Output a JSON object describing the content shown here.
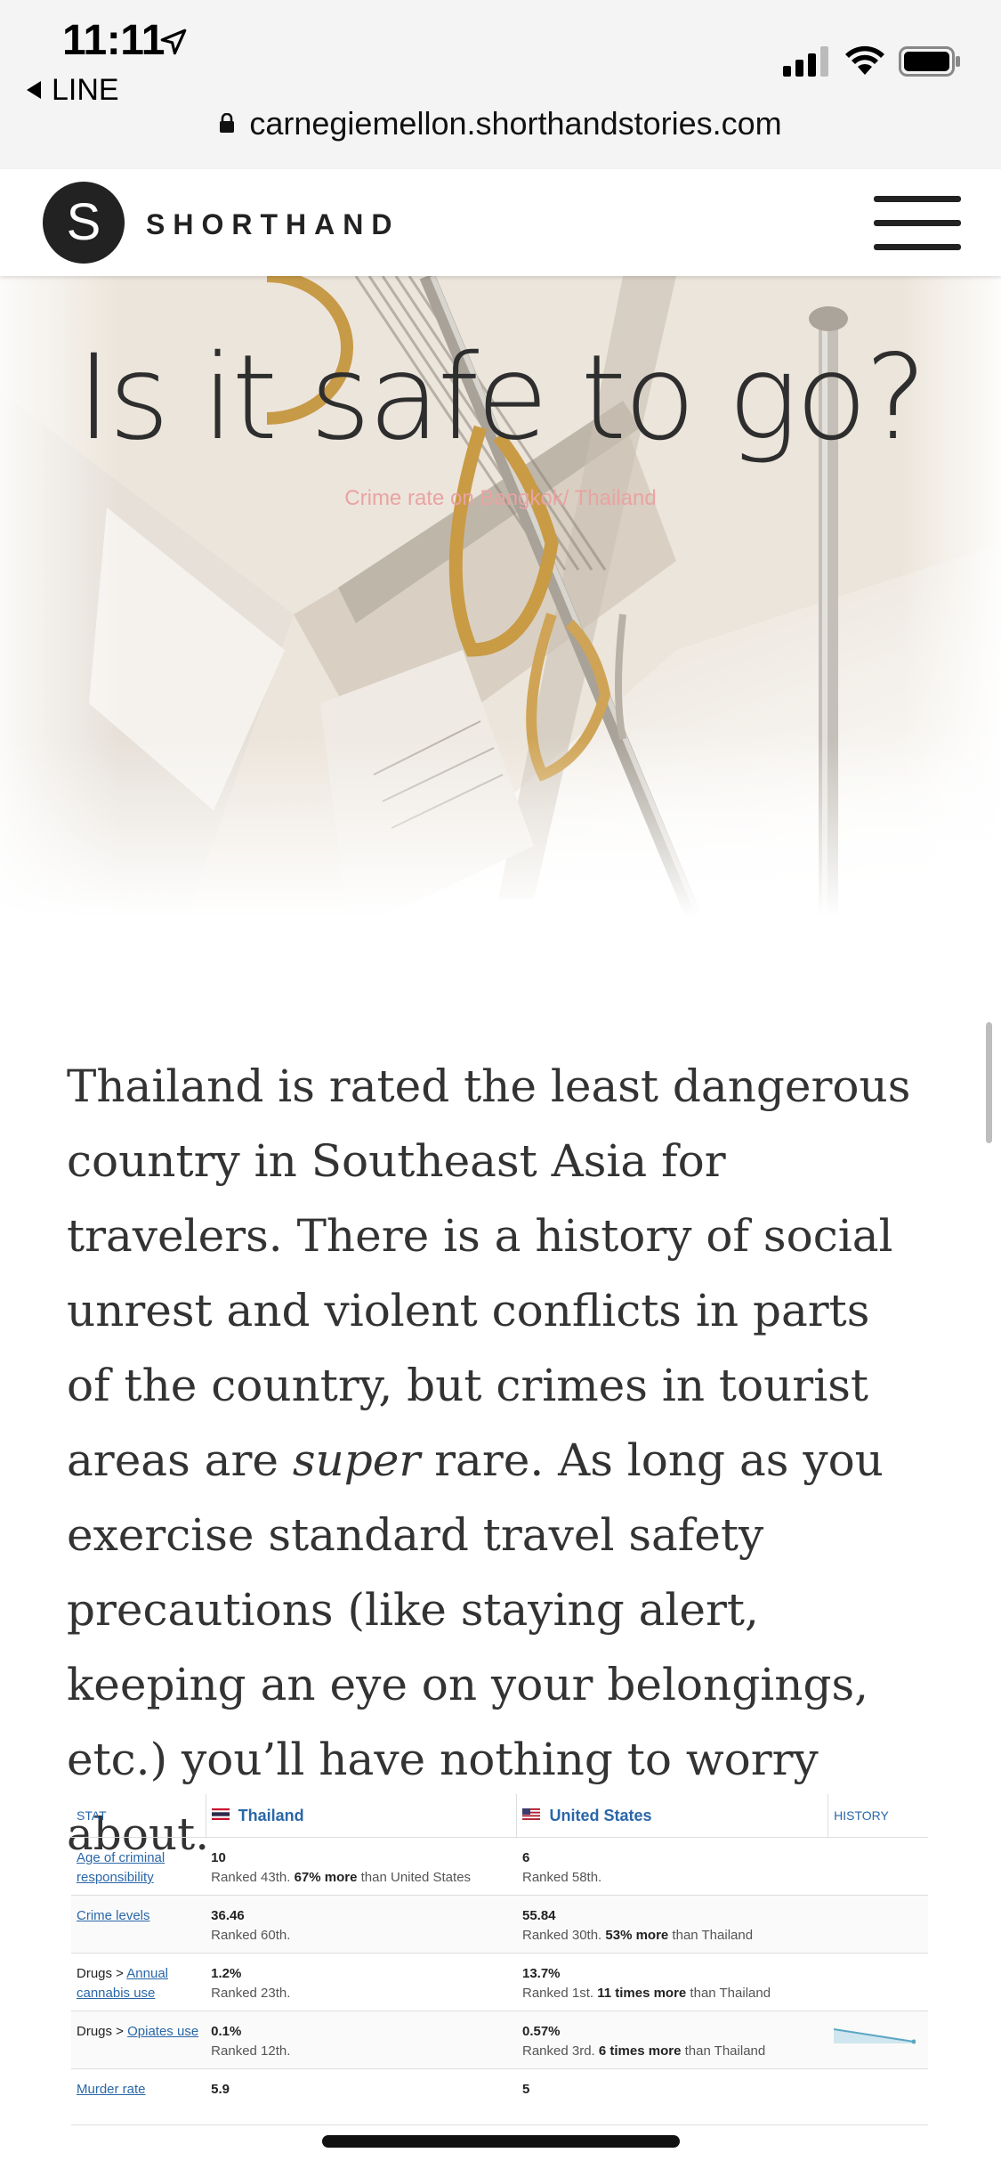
{
  "status_bar": {
    "time": "11:11",
    "back_app": "LINE"
  },
  "url_bar": {
    "url": "carnegiemellon.shorthandstories.com"
  },
  "site_header": {
    "logo_letter": "S",
    "logo_text": "SHORTHAND"
  },
  "hero": {
    "title": "Is it safe to go?",
    "subtitle": "Crime rate on Bangkok/ Thailand"
  },
  "article": {
    "before_em": "Thailand is rated the least dangerous country in Southeast Asia for travelers. There is a history of social unrest and violent conflicts in parts of the country, but crimes in tourist areas are ",
    "em": "super",
    "after_em": " rare. As long as you exercise standard travel safety precautions (like staying alert, keeping an eye on your belongings, etc.) you’ll have nothing to worry about."
  },
  "stats_table": {
    "headers": {
      "stat": "STAT",
      "country1": "Thailand",
      "country2": "United States",
      "history": "HISTORY"
    },
    "rows": [
      {
        "stat": "Age of criminal responsibility",
        "v1": "10",
        "r1_pre": "Ranked 43th. ",
        "r1_bold": "67% more",
        "r1_post": " than United States",
        "v2": "6",
        "r2_pre": "Ranked 58th.",
        "r2_bold": "",
        "r2_post": ""
      },
      {
        "stat": "Crime levels",
        "v1": "36.46",
        "r1_pre": "Ranked 60th.",
        "r1_bold": "",
        "r1_post": "",
        "v2": "55.84",
        "r2_pre": "Ranked 30th. ",
        "r2_bold": "53% more",
        "r2_post": " than Thailand"
      },
      {
        "stat_prefix": "Drugs > ",
        "stat": "Annual cannabis use",
        "v1": "1.2%",
        "r1_pre": "Ranked 23th.",
        "r1_bold": "",
        "r1_post": "",
        "v2": "13.7%",
        "r2_pre": "Ranked 1st. ",
        "r2_bold": "11 times more",
        "r2_post": " than Thailand"
      },
      {
        "stat_prefix": "Drugs > ",
        "stat": "Opiates use",
        "v1": "0.1%",
        "r1_pre": "Ranked 12th.",
        "r1_bold": "",
        "r1_post": "",
        "v2": "0.57%",
        "r2_pre": "Ranked 3rd. ",
        "r2_bold": "6 times more",
        "r2_post": " than Thailand"
      },
      {
        "stat": "Murder rate",
        "v1": "5.9",
        "r1_pre": "",
        "r1_bold": "",
        "r1_post": "",
        "v2": "5",
        "r2_pre": "",
        "r2_bold": "",
        "r2_post": ""
      }
    ]
  },
  "colors": {
    "link": "#2a67a8",
    "subtitle": "#e9a3a3",
    "title": "#2e2e2e"
  }
}
